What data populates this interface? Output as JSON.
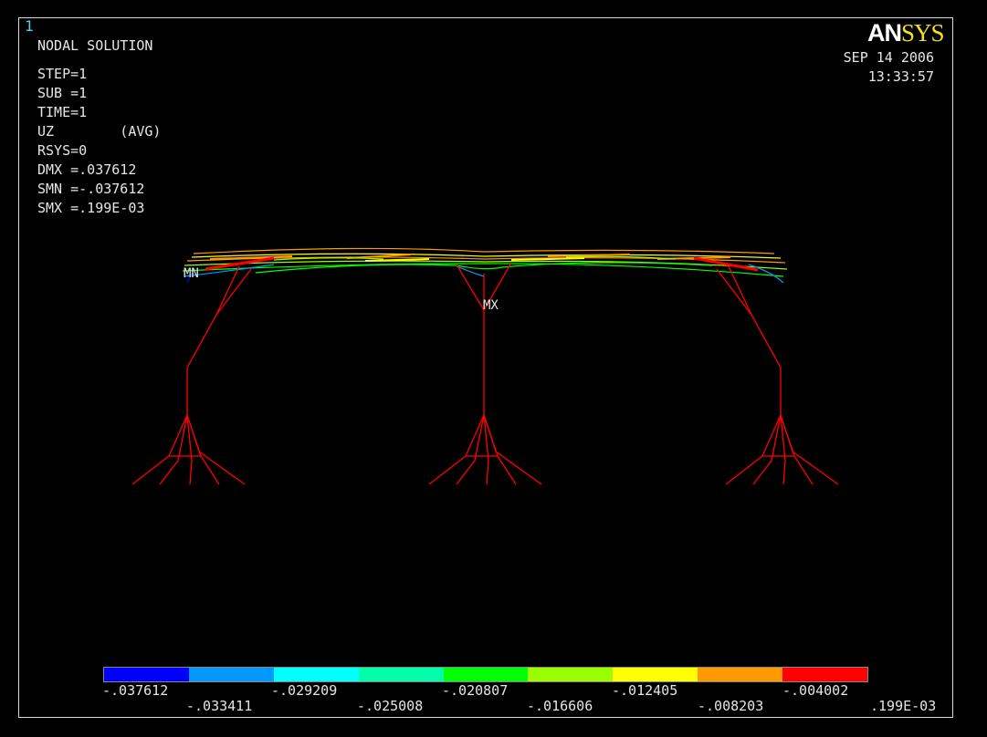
{
  "window_number": "1",
  "logo": {
    "part1": "AN",
    "part2": "SYS"
  },
  "date": "SEP 14 2006",
  "time": "13:33:57",
  "info_lines": [
    "NODAL SOLUTION",
    "STEP=1",
    "SUB =1",
    "TIME=1",
    "UZ        (AVG)",
    "RSYS=0",
    "DMX =.037612",
    "SMN =-.037612",
    "SMX =.199E-03"
  ],
  "markers": {
    "min": "MN",
    "max": "MX"
  },
  "legend": {
    "colors": [
      "#0000ff",
      "#0099ff",
      "#00ffff",
      "#00ffaa",
      "#00ff00",
      "#99ff00",
      "#ffff00",
      "#ff9900",
      "#ff0000"
    ],
    "labels_top": [
      "-.037612",
      "-.029209",
      "-.020807",
      "-.012405",
      "-.004002"
    ],
    "labels_bottom": [
      "-.033411",
      "-.025008",
      "-.016606",
      "-.008203",
      ".199E-03"
    ]
  },
  "colors": {
    "structure": "#ff0000",
    "background": "#000000"
  }
}
